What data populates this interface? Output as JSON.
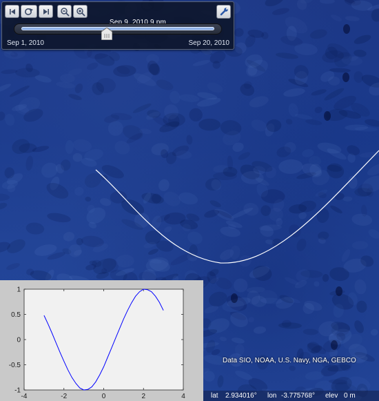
{
  "time_slider": {
    "current_time": "Sep  9, 2010   9 pm",
    "range_start": "Sep  1, 2010",
    "range_end": "Sep 20, 2010",
    "position_fraction": 0.44
  },
  "attribution": "Data SIO, NOAA, U.S. Navy, NGA, GEBCO",
  "status": {
    "lat_label": "lat",
    "lat_value": "2.934016°",
    "lon_label": "lon",
    "lon_value": "-3.775768°",
    "elev_label": "elev",
    "elev_value": "0 m"
  },
  "icons": {
    "prev": "skip-back-icon",
    "animate": "play-loop-icon",
    "next": "skip-forward-icon",
    "zoom_out": "zoom-out-icon",
    "zoom_in": "zoom-in-icon",
    "settings": "wrench-icon"
  },
  "colors": {
    "ocean": "#1d3a8a",
    "track": "#ffffff",
    "plot_line": "#0000ff"
  },
  "chart_data": {
    "type": "line",
    "title": "",
    "xlabel": "",
    "ylabel": "",
    "xlim": [
      -4,
      4
    ],
    "ylim": [
      -1,
      1
    ],
    "xticks": [
      "-4",
      "-2",
      "0",
      "2",
      "4"
    ],
    "yticks": [
      "-1",
      "-0.5",
      "0",
      "0.5",
      "1"
    ],
    "series": [
      {
        "x": [
          -3.0,
          -2.8,
          -2.6,
          -2.4,
          -2.2,
          -2.0,
          -1.8,
          -1.6,
          -1.4,
          -1.2,
          -1.0,
          -0.8,
          -0.6,
          -0.4,
          -0.2,
          0.0,
          0.2,
          0.4,
          0.6,
          0.8,
          1.0,
          1.2,
          1.4,
          1.6,
          1.8,
          2.0,
          2.2,
          2.4,
          2.6,
          2.8,
          3.0
        ],
        "y": [
          0.48,
          0.31,
          0.13,
          -0.06,
          -0.25,
          -0.43,
          -0.6,
          -0.75,
          -0.87,
          -0.96,
          -1.0,
          -0.99,
          -0.94,
          -0.84,
          -0.7,
          -0.54,
          -0.35,
          -0.16,
          0.03,
          0.22,
          0.41,
          0.58,
          0.73,
          0.86,
          0.95,
          1.0,
          0.99,
          0.95,
          0.86,
          0.74,
          0.58
        ]
      }
    ]
  }
}
